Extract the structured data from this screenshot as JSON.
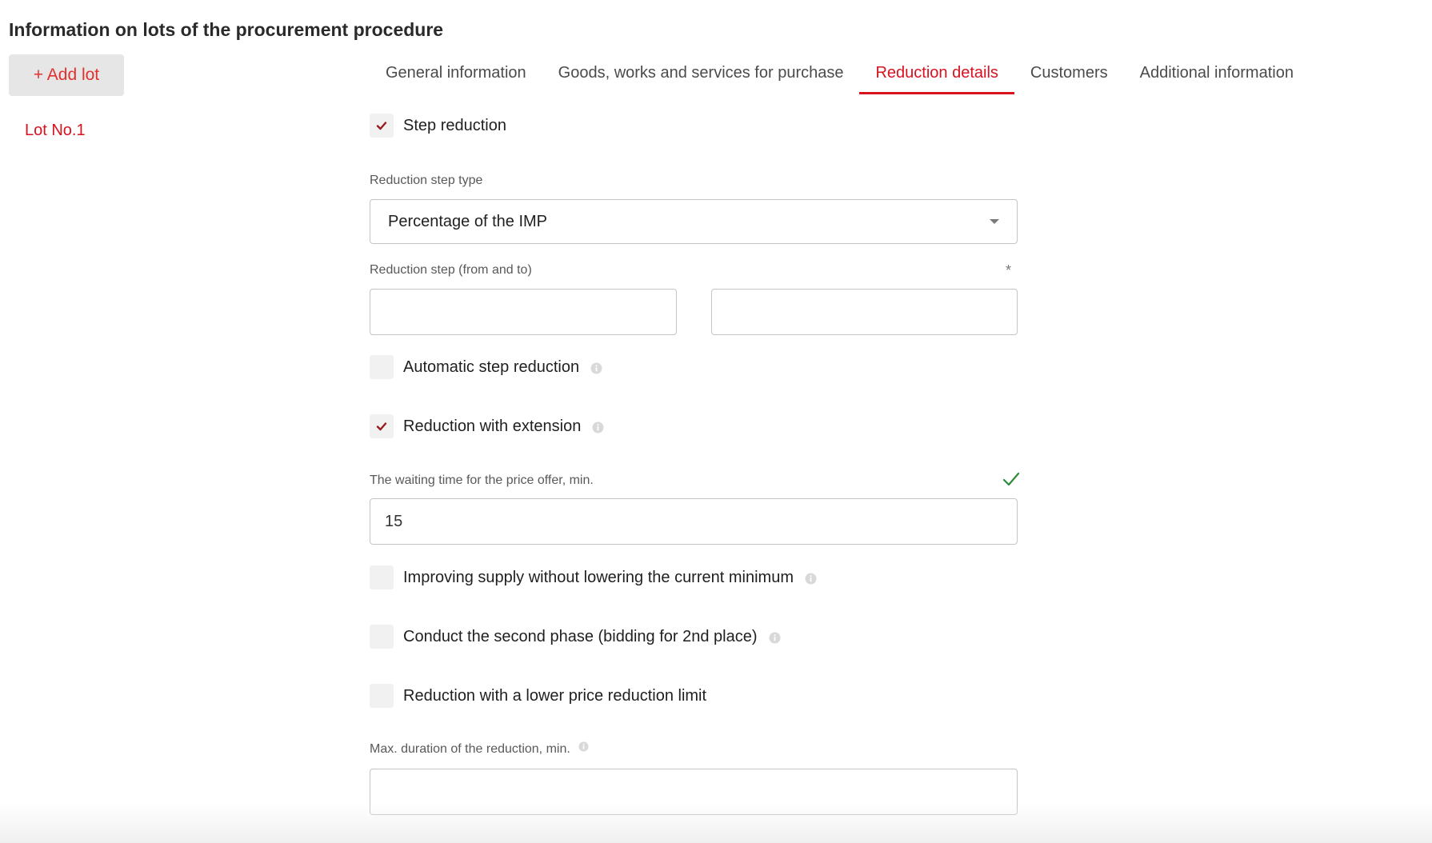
{
  "page": {
    "title": "Information on lots of the procurement procedure"
  },
  "sidebar": {
    "add_lot_label": "+ Add lot",
    "lots": [
      {
        "label": "Lot No.1"
      }
    ]
  },
  "tabs": [
    {
      "label": "General information",
      "active": false
    },
    {
      "label": "Goods, works and services for purchase",
      "active": false
    },
    {
      "label": "Reduction details",
      "active": true
    },
    {
      "label": "Customers",
      "active": false
    },
    {
      "label": "Additional information",
      "active": false
    }
  ],
  "form": {
    "step_reduction": {
      "label": "Step reduction",
      "checked": true
    },
    "reduction_step_type": {
      "label": "Reduction step type",
      "value": "Percentage of the IMP"
    },
    "reduction_step": {
      "label": "Reduction step (from and to)",
      "required_mark": "*",
      "from_value": "",
      "to_value": ""
    },
    "automatic_step_reduction": {
      "label": "Automatic step reduction",
      "checked": false
    },
    "reduction_with_extension": {
      "label": "Reduction with extension",
      "checked": true
    },
    "waiting_time": {
      "label": "The waiting time for the price offer, min.",
      "value": "15"
    },
    "improving_supply": {
      "label": "Improving supply without lowering the current minimum",
      "checked": false
    },
    "second_phase": {
      "label": "Conduct the second phase (bidding for 2nd place)",
      "checked": false
    },
    "lower_price_limit": {
      "label": "Reduction with a lower price reduction limit",
      "checked": false
    },
    "max_duration": {
      "label": "Max. duration of the reduction, min.",
      "value": ""
    }
  },
  "colors": {
    "accent": "#d8121f",
    "check_mark": "#9b1c1c",
    "valid": "#2e8b3a"
  }
}
